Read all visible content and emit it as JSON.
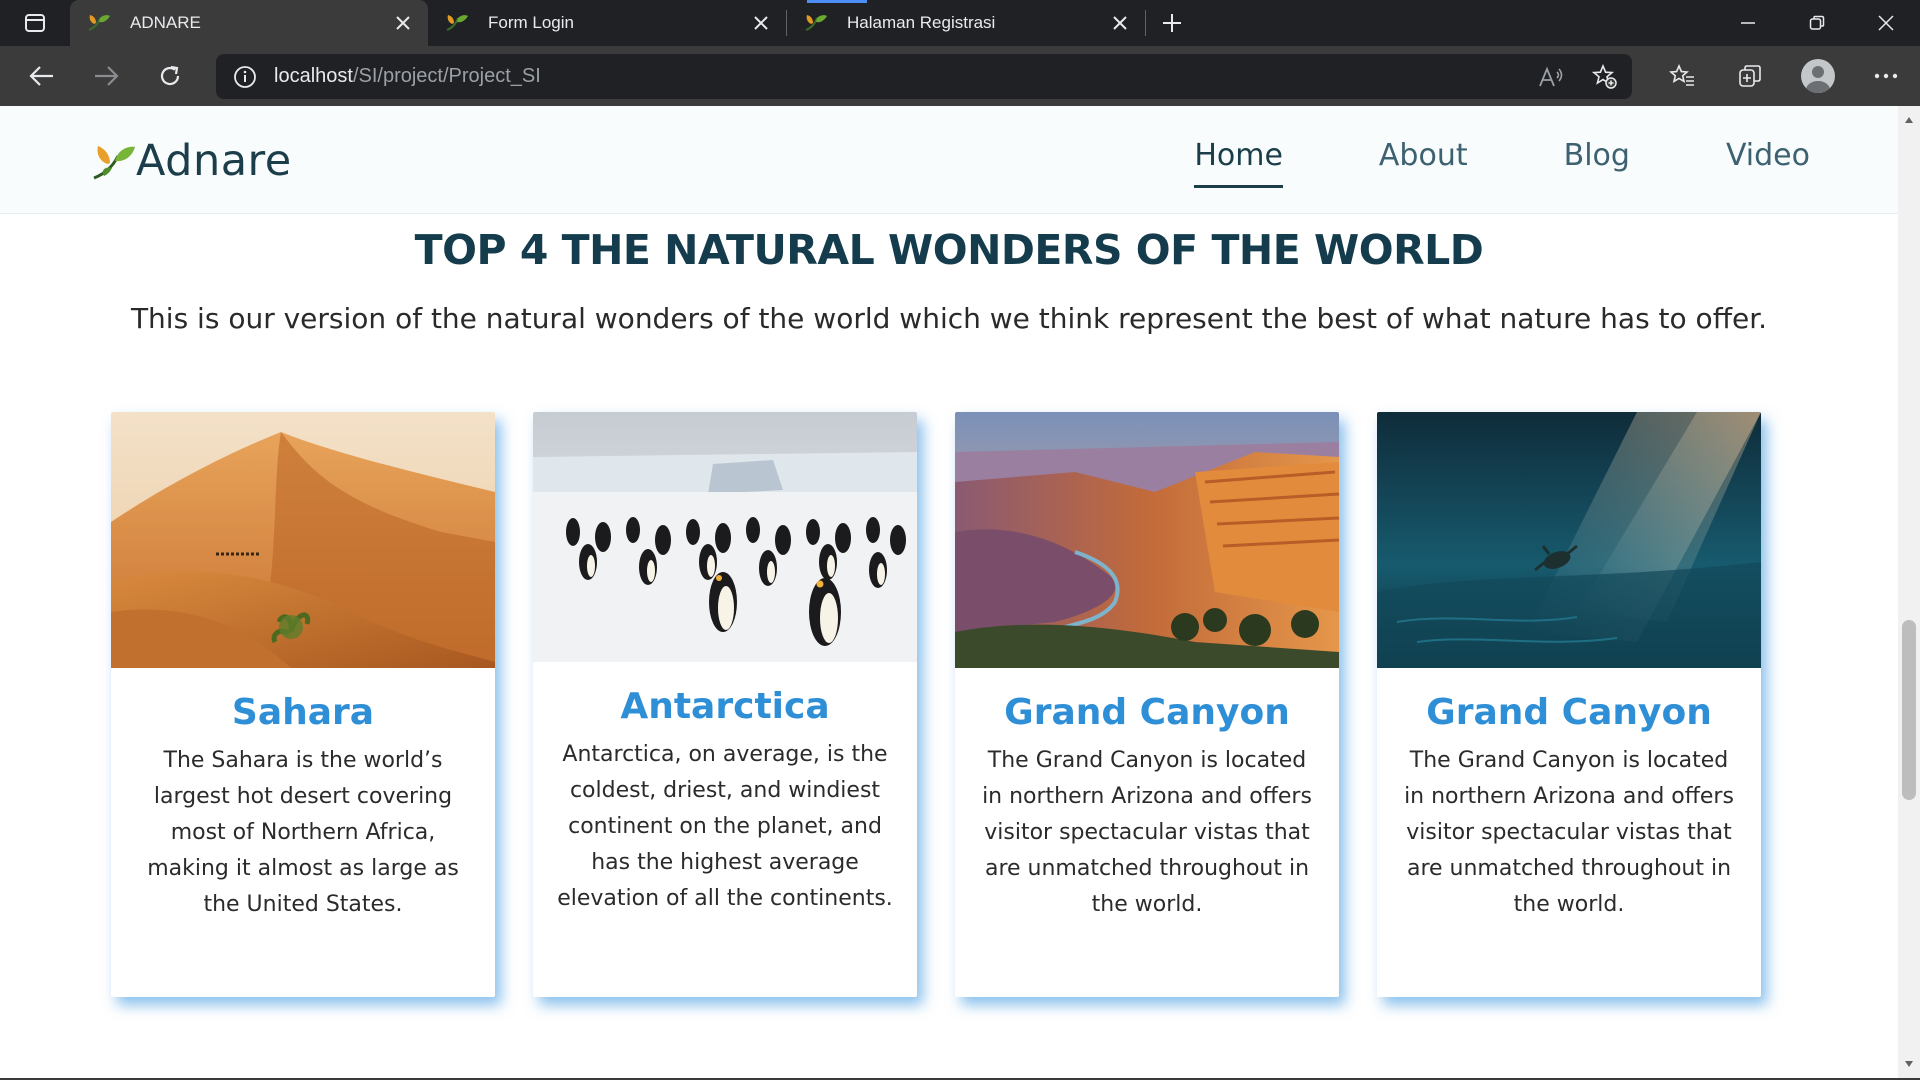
{
  "browser": {
    "tabs": [
      {
        "title": "ADNARE",
        "active": true
      },
      {
        "title": "Form Login",
        "active": false
      },
      {
        "title": "Halaman Registrasi",
        "active": false
      }
    ],
    "url_host": "localhost",
    "url_path": "/SI/project/Project_SI"
  },
  "site": {
    "logo_text": "Adnare",
    "nav": [
      {
        "label": "Home",
        "active": true
      },
      {
        "label": "About",
        "active": false
      },
      {
        "label": "Blog",
        "active": false
      },
      {
        "label": "Video",
        "active": false
      }
    ]
  },
  "section": {
    "title": "TOP 4 THE NATURAL WONDERS OF THE WORLD",
    "subtitle": "This is our version of the natural wonders of the world which we think represent the best of what nature has to offer.",
    "cards": [
      {
        "title": "Sahara",
        "text": "The Sahara is the world’s largest hot desert covering most of Northern Africa, making it almost as large as the United States.",
        "image": "desert-dunes-photo"
      },
      {
        "title": "Antarctica",
        "text": "Antarctica, on average, is the coldest, driest, and windiest continent on the planet, and has the highest average elevation of all the continents.",
        "image": "penguin-colony-photo"
      },
      {
        "title": "Grand Canyon",
        "text": "The Grand Canyon is located in northern Arizona and offers visitor spectacular vistas that are unmatched throughout in the world.",
        "image": "canyon-photo"
      },
      {
        "title": "Grand Canyon",
        "text": "The Grand Canyon is located in northern Arizona and offers visitor spectacular vistas that are unmatched throughout in the world.",
        "image": "underwater-turtle-photo"
      }
    ]
  },
  "colors": {
    "brand_dark": "#1c3e4b",
    "card_title": "#2f8fd6",
    "card_shadow": "#288cdc"
  }
}
